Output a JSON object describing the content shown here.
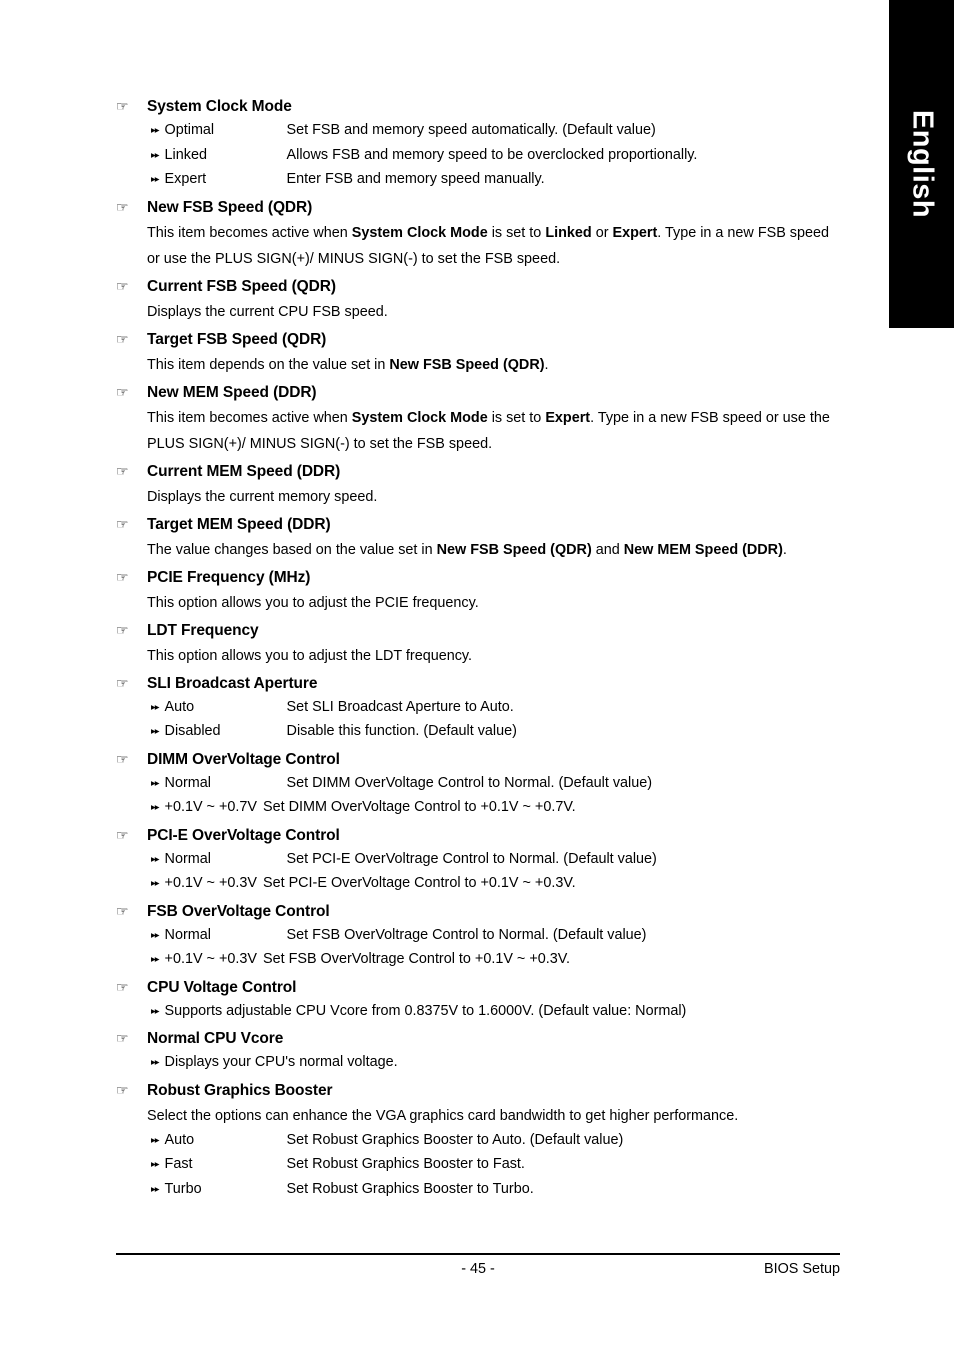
{
  "language_tab": {
    "label": "English"
  },
  "icons": {
    "heading_bullet": "☞",
    "option_bullet": "▸▸"
  },
  "footer": {
    "page_number": "- 45 -",
    "document_label": "BIOS Setup"
  },
  "sections": [
    {
      "title": "System Clock Mode",
      "options": [
        {
          "label": "Optimal",
          "desc": "Set FSB and memory speed automatically. (Default value)"
        },
        {
          "label": "Linked",
          "desc": "Allows FSB and memory speed to be overclocked proportionally."
        },
        {
          "label": "Expert",
          "desc": "Enter FSB and memory speed manually."
        }
      ]
    },
    {
      "title": "New FSB Speed (QDR)",
      "paragraph_html": "This item becomes active when <b>System Clock Mode</b> is set to <b>Linked</b> or <b>Expert</b>. Type in a new FSB speed or use the PLUS SIGN(+)/ MINUS SIGN(-) to set the FSB speed."
    },
    {
      "title": "Current FSB Speed (QDR)",
      "paragraph_html": "Displays the current CPU FSB speed."
    },
    {
      "title": "Target FSB Speed (QDR)",
      "paragraph_html": "This item depends on the value set in <b>New FSB Speed (QDR)</b>."
    },
    {
      "title": "New MEM Speed (DDR)",
      "paragraph_html": "This item becomes active when <b>System Clock Mode</b> is set to <b>Expert</b>. Type in a new FSB speed or use the PLUS SIGN(+)/ MINUS SIGN(-) to set the FSB speed."
    },
    {
      "title": "Current MEM Speed (DDR)",
      "paragraph_html": "Displays the current memory speed."
    },
    {
      "title": "Target MEM Speed (DDR)",
      "paragraph_html": "The value changes based on the value set in <b>New FSB Speed (QDR)</b> and <b>New MEM Speed (DDR)</b>."
    },
    {
      "title": "PCIE Frequency (MHz)",
      "paragraph_html": "This option allows you to adjust the PCIE frequency."
    },
    {
      "title": "LDT Frequency",
      "paragraph_html": "This option allows you to adjust the LDT frequency."
    },
    {
      "title": "SLI Broadcast Aperture",
      "options": [
        {
          "label": "Auto",
          "desc": "Set SLI Broadcast Aperture to Auto."
        },
        {
          "label": "Disabled",
          "desc": "Disable this function. (Default value)"
        }
      ]
    },
    {
      "title": "DIMM OverVoltage Control",
      "options": [
        {
          "label": "Normal",
          "desc": "Set DIMM OverVoltage Control to Normal. (Default value)"
        },
        {
          "label": "+0.1V ~ +0.7V",
          "desc": "Set DIMM OverVoltage Control to +0.1V ~ +0.7V.",
          "wide": true
        }
      ]
    },
    {
      "title": "PCI-E OverVoltage Control",
      "options": [
        {
          "label": "Normal",
          "desc": "Set PCI-E OverVoltrage Control to Normal. (Default value)"
        },
        {
          "label": "+0.1V ~ +0.3V",
          "desc": "Set PCI-E OverVoltage Control to +0.1V ~ +0.3V.",
          "wide": true
        }
      ]
    },
    {
      "title": "FSB OverVoltage Control",
      "options": [
        {
          "label": "Normal",
          "desc": "Set FSB OverVoltrage Control to Normal. (Default value)"
        },
        {
          "label": "+0.1V ~ +0.3V",
          "desc": "Set FSB OverVoltrage Control to +0.1V ~ +0.3V.",
          "wide": true
        }
      ]
    },
    {
      "title": "CPU Voltage Control",
      "options": [
        {
          "label": "",
          "desc": "Supports adjustable CPU Vcore from 0.8375V to 1.6000V. (Default value: Normal)",
          "flow": true
        }
      ]
    },
    {
      "title": "Normal CPU Vcore",
      "options": [
        {
          "label": "",
          "desc": "Displays your CPU's normal voltage.",
          "flow": true
        }
      ]
    },
    {
      "title": "Robust Graphics Booster",
      "paragraph_html": "Select the options can enhance the VGA graphics card bandwidth to get higher performance.",
      "options": [
        {
          "label": "Auto",
          "desc": "Set Robust Graphics Booster to Auto. (Default value)"
        },
        {
          "label": "Fast",
          "desc": "Set Robust Graphics Booster to Fast."
        },
        {
          "label": "Turbo",
          "desc": "Set Robust Graphics Booster to Turbo."
        }
      ]
    }
  ]
}
